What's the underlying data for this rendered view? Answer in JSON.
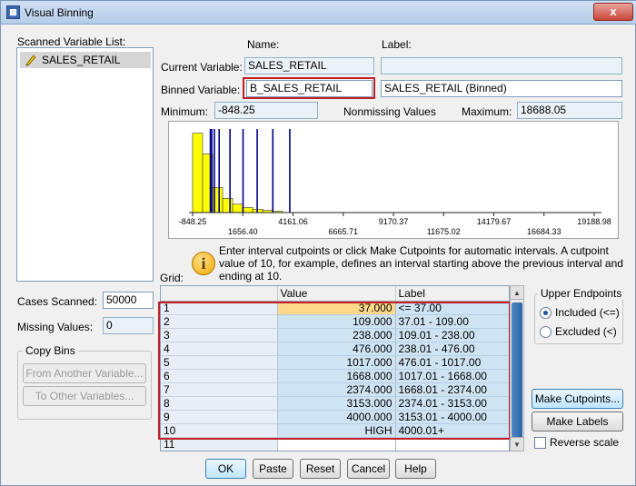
{
  "window": {
    "title": "Visual Binning",
    "close_label": "x"
  },
  "variable_list": {
    "label": "Scanned Variable List:",
    "items": [
      "SALES_RETAIL"
    ]
  },
  "names": {
    "name_header": "Name:",
    "label_header": "Label:",
    "current_variable_label": "Current Variable:",
    "current_variable_name": "SALES_RETAIL",
    "current_variable_label_value": "",
    "binned_variable_label": "Binned Variable:",
    "binned_variable_name": "B_SALES_RETAIL",
    "binned_variable_label_value": "SALES_RETAIL (Binned)"
  },
  "stats": {
    "minimum_label": "Minimum:",
    "minimum_value": "-848.25",
    "nonmissing_label": "Nonmissing Values",
    "maximum_label": "Maximum:",
    "maximum_value": "18688.05"
  },
  "chart_data": {
    "type": "bar",
    "x_tick_labels_top": [
      "-848.25",
      "4161.06",
      "9170.37",
      "14179.67",
      "19188.98"
    ],
    "x_tick_labels_bottom": [
      "1656.40",
      "6665.71",
      "11675.02",
      "16684.33"
    ],
    "xlim": [
      -848.25,
      19188.98
    ],
    "histogram_bins": [
      {
        "x": -600,
        "height": 0.95
      },
      {
        "x": -100,
        "height": 0.7
      },
      {
        "x": 400,
        "height": 0.3
      },
      {
        "x": 900,
        "height": 0.17
      },
      {
        "x": 1400,
        "height": 0.1
      },
      {
        "x": 1900,
        "height": 0.06
      },
      {
        "x": 2400,
        "height": 0.04
      },
      {
        "x": 2900,
        "height": 0.025
      },
      {
        "x": 3400,
        "height": 0.015
      }
    ],
    "cutpoints": [
      37,
      109,
      238,
      476,
      1017,
      1668,
      2374,
      3153,
      4000
    ]
  },
  "info": {
    "text": "Enter interval cutpoints or click Make Cutpoints for automatic intervals. A cutpoint value of 10, for example, defines an interval starting above the previous interval and ending at 10."
  },
  "grid": {
    "label": "Grid:",
    "headers": [
      "",
      "Value",
      "Label"
    ],
    "rows": [
      {
        "num": "1",
        "value": "37.000",
        "label": "<= 37.00"
      },
      {
        "num": "2",
        "value": "109.000",
        "label": "37.01 - 109.00"
      },
      {
        "num": "3",
        "value": "238.000",
        "label": "109.01 - 238.00"
      },
      {
        "num": "4",
        "value": "476.000",
        "label": "238.01 - 476.00"
      },
      {
        "num": "5",
        "value": "1017.000",
        "label": "476.01 - 1017.00"
      },
      {
        "num": "6",
        "value": "1668.000",
        "label": "1017.01 - 1668.00"
      },
      {
        "num": "7",
        "value": "2374.000",
        "label": "1668.01 - 2374.00"
      },
      {
        "num": "8",
        "value": "3153.000",
        "label": "2374.01 - 3153.00"
      },
      {
        "num": "9",
        "value": "4000.000",
        "label": "3153.01 - 4000.00"
      },
      {
        "num": "10",
        "value": "HIGH",
        "label": "4000.01+"
      },
      {
        "num": "11",
        "value": "",
        "label": ""
      }
    ]
  },
  "cases": {
    "scanned_label": "Cases Scanned:",
    "scanned_value": "50000",
    "missing_label": "Missing Values:",
    "missing_value": "0"
  },
  "copy_bins": {
    "title": "Copy Bins",
    "from_label": "From Another Variable...",
    "to_label": "To Other Variables..."
  },
  "endpoints": {
    "title": "Upper Endpoints",
    "included_label": "Included (<=)",
    "excluded_label": "Excluded (<)",
    "selected": "included"
  },
  "actions": {
    "make_cutpoints": "Make Cutpoints...",
    "make_labels": "Make Labels",
    "reverse_scale": "Reverse scale",
    "ok": "OK",
    "paste": "Paste",
    "reset": "Reset",
    "cancel": "Cancel",
    "help": "Help"
  },
  "colors": {
    "bar_fill": "#ffff00",
    "cutline": "#00008b",
    "red_box": "#c0202a"
  }
}
